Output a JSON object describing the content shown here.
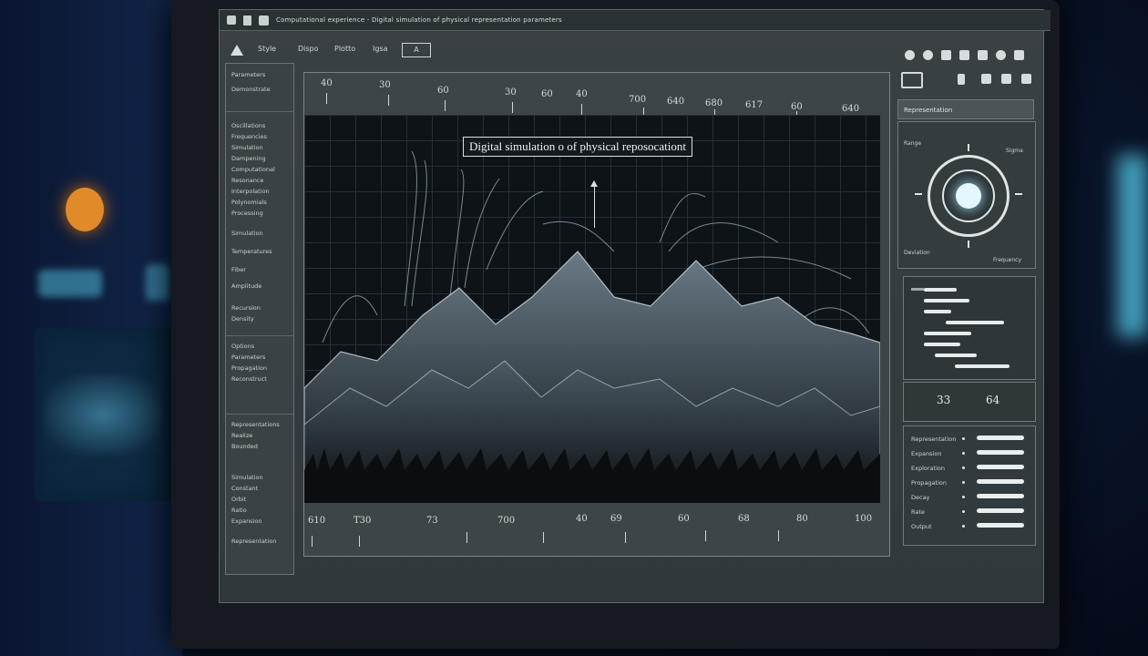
{
  "window": {
    "menubar_text": "Computational experience - Digital simulation of physical representation parameters"
  },
  "toolbar": {
    "items": [
      "Style",
      "Dispo",
      "Plotto",
      "Igsa"
    ],
    "button_label": "A"
  },
  "sidebar": {
    "items": [
      "Parameters",
      "Demonstrate",
      "Oscillations",
      "Frequencies",
      "Simulation",
      "Dampening",
      "Computational",
      "Resonance",
      "Interpolation",
      "Polynomials",
      "Processing",
      "Simulation",
      "Temperatures",
      "Fiber",
      "Amplitude",
      "Recursion",
      "Density",
      "Options",
      "Parameters",
      "Propagation",
      "Reconstruct",
      "Representations",
      "Realize",
      "Bounded",
      "Simulation",
      "Constant",
      "Orbit",
      "Ratio",
      "Expansion",
      "Representation"
    ]
  },
  "plot": {
    "top_ruler": [
      "40",
      "30",
      "60",
      "30",
      "60",
      "40",
      "700",
      "640",
      "680",
      "617",
      "60",
      "640"
    ],
    "annotation": "Digital simulation o of physical reposocationt",
    "bottom_ruler": [
      "610",
      "T30",
      "73",
      "700",
      "40",
      "69",
      "60",
      "68",
      "80",
      "100"
    ]
  },
  "right_panel": {
    "header": "Representation",
    "gauge_labels": [
      "Range",
      "Sigma",
      "Deviation",
      "Frequency"
    ],
    "values": [
      "33",
      "64"
    ],
    "list": [
      "Representation",
      "Expansion",
      "Exploration",
      "Propagation",
      "Decay",
      "Rate",
      "Output"
    ]
  }
}
